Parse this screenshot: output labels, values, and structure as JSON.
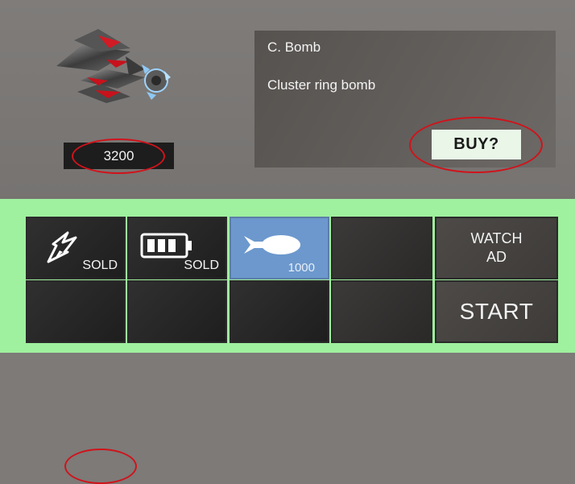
{
  "preview": {
    "item_icon": "bomb-ship-icon",
    "price": "3200"
  },
  "info": {
    "title": "C. Bomb",
    "description": "Cluster ring bomb",
    "buy_label": "BUY?"
  },
  "slots": [
    {
      "icon": "flame-rocket-icon",
      "label": "SOLD"
    },
    {
      "icon": "battery-icon",
      "label": "SOLD"
    },
    {
      "icon": "bomb-icon",
      "price": "1000",
      "selected": true
    },
    {
      "icon": "",
      "label": ""
    }
  ],
  "actions": {
    "watch_ad_line1": "WATCH",
    "watch_ad_line2": "AD",
    "start_label": "START"
  },
  "colors": {
    "shop_bg": "#9ff09f",
    "selected_slot": "#6c98cd",
    "highlight_oval": "#d0131b"
  }
}
